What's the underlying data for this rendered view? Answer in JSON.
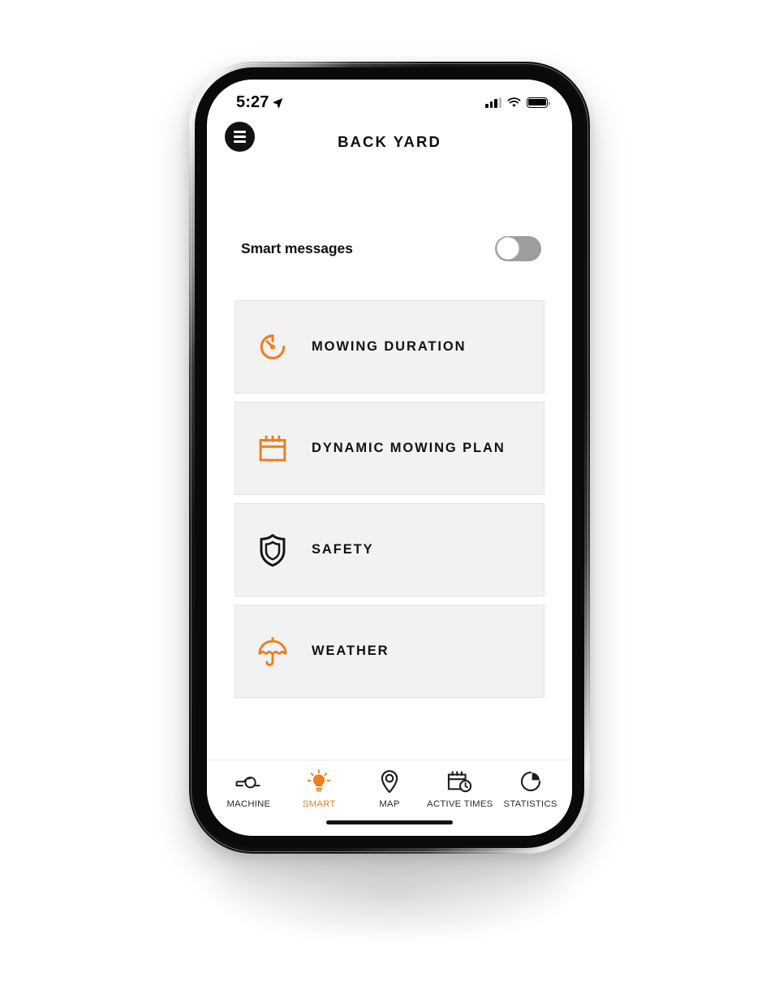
{
  "colors": {
    "accent": "#ef7e20",
    "card_bg": "#f2f2f2",
    "card_border": "#e2e2e2",
    "text": "#111111",
    "toggle_off_track": "#9d9d9d",
    "icon_black": "#141414"
  },
  "statusbar": {
    "time": "5:27",
    "location_icon": "location-arrow-icon",
    "signal_icon": "cellular-signal-icon",
    "wifi_icon": "wifi-icon",
    "battery_icon": "battery-full-icon"
  },
  "header": {
    "menu_icon": "hamburger-menu-icon",
    "title": "BACK YARD"
  },
  "smart_messages": {
    "label": "Smart messages",
    "toggle_state": "off"
  },
  "cards": [
    {
      "label": "MOWING DURATION",
      "icon": "stopwatch-icon",
      "icon_color": "#ef7e20"
    },
    {
      "label": "DYNAMIC MOWING PLAN",
      "icon": "calendar-icon",
      "icon_color": "#ef7e20"
    },
    {
      "label": "SAFETY",
      "icon": "shield-icon",
      "icon_color": "#141414"
    },
    {
      "label": "WEATHER",
      "icon": "umbrella-icon",
      "icon_color": "#ef7e20"
    }
  ],
  "tabbar": [
    {
      "label": "MACHINE",
      "icon": "mower-icon",
      "active": false
    },
    {
      "label": "SMART",
      "icon": "lightbulb-icon",
      "active": true
    },
    {
      "label": "MAP",
      "icon": "map-pin-icon",
      "active": false
    },
    {
      "label": "ACTIVE TIMES",
      "icon": "calendar-clock-icon",
      "active": false
    },
    {
      "label": "STATISTICS",
      "icon": "pie-chart-icon",
      "active": false
    }
  ]
}
